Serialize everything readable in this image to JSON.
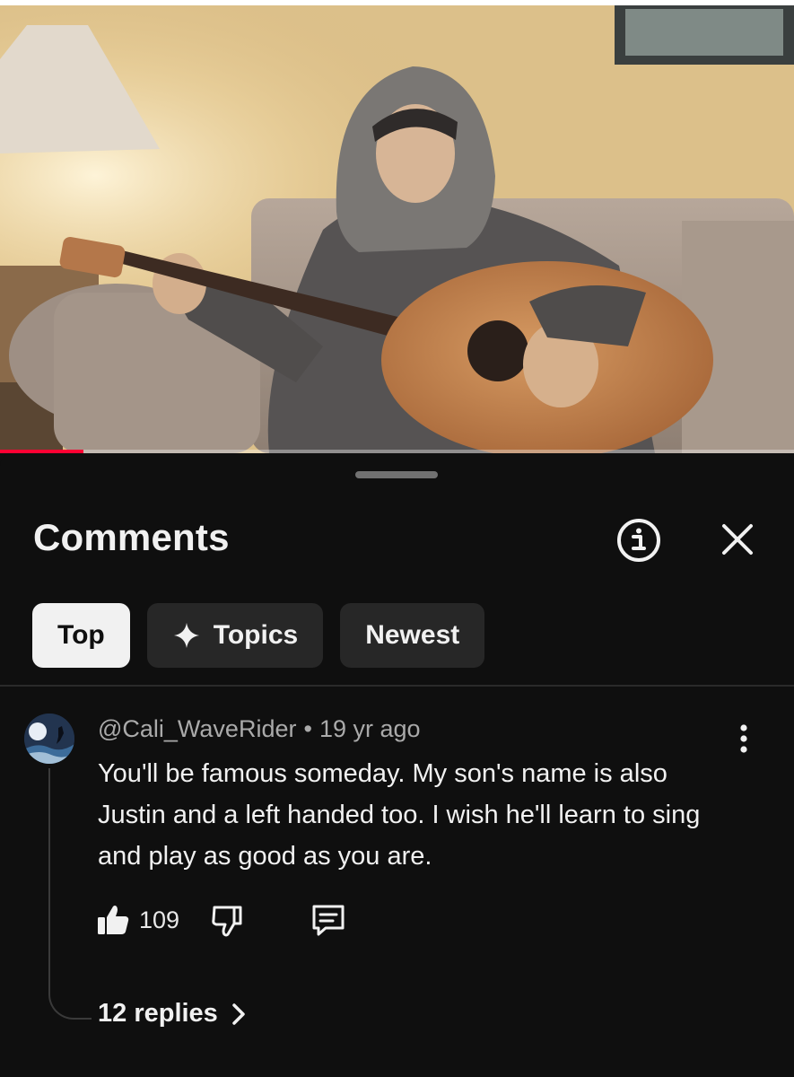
{
  "video": {
    "progress_fraction": 0.105
  },
  "comments_panel": {
    "title": "Comments",
    "filters": [
      {
        "label": "Top",
        "active": true
      },
      {
        "label": "Topics",
        "active": false,
        "icon": "sparkle-icon"
      },
      {
        "label": "Newest",
        "active": false
      }
    ]
  },
  "comment": {
    "author": "@Cali_WaveRider",
    "separator": "•",
    "timestamp": "19 yr ago",
    "text": "You'll be famous someday. My son's name is also Justin and a left handed too. I wish he'll learn to sing and play as good as you are.",
    "likes": "109",
    "replies_label": "12 replies"
  },
  "colors": {
    "background": "#0f0f0f",
    "chip": "#272727",
    "chip_active": "#f1f1f1",
    "secondary_text": "#aaaaaa",
    "progress": "#ff0033"
  }
}
